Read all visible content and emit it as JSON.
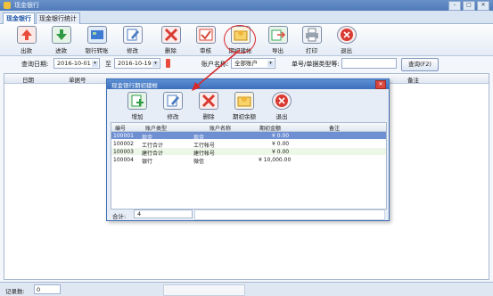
{
  "window": {
    "title": "现金银行",
    "min": "–",
    "max": "□",
    "close": "✕"
  },
  "tabs": [
    {
      "label": "现金银行"
    },
    {
      "label": "现金银行统计"
    }
  ],
  "toolbar": [
    {
      "label": "出款",
      "icon": "withdraw-icon",
      "color": "#e74c3c"
    },
    {
      "label": "进款",
      "icon": "deposit-icon",
      "color": "#2e9a43"
    },
    {
      "label": "银行转账",
      "icon": "bank-transfer-icon",
      "color": "#3c7bd1"
    },
    {
      "label": "修改",
      "icon": "edit-icon",
      "color": "#4d7fc2"
    },
    {
      "label": "删除",
      "icon": "delete-icon",
      "color": "#d93a32"
    },
    {
      "label": "审核",
      "icon": "audit-icon",
      "color": "#d94a3a"
    },
    {
      "label": "期初建帐",
      "icon": "opening-balance-icon",
      "color": "#f0b43a"
    },
    {
      "label": "导出",
      "icon": "export-icon",
      "color": "#3ca65c"
    },
    {
      "label": "打印",
      "icon": "print-icon",
      "color": "#7a8494"
    },
    {
      "label": "退出",
      "icon": "exit-icon",
      "color": "#d93a32"
    }
  ],
  "filter": {
    "date_label": "查询日期:",
    "date_from": "2016-10-01",
    "to_label": "至",
    "date_to": "2016-10-19",
    "account_label": "账户名称:",
    "account_value": "全部账户",
    "number_label": "单号/单据类型等:",
    "number_value": "",
    "query_button": "查询(F2)"
  },
  "grid": {
    "columns": [
      "日期",
      "单据号",
      "",
      "",
      "",
      "",
      "",
      "",
      "备注"
    ]
  },
  "status": {
    "label": "记录数:",
    "value": "0"
  },
  "dialog": {
    "title": "现金银行期初建帐",
    "close": "✕",
    "buttons": [
      {
        "label": "增加",
        "icon": "add-icon",
        "color": "#2e9a43"
      },
      {
        "label": "修改",
        "icon": "edit-icon",
        "color": "#4d7fc2"
      },
      {
        "label": "删除",
        "icon": "delete-icon",
        "color": "#d93a32"
      },
      {
        "label": "期初余额",
        "icon": "opening-balance-icon",
        "color": "#f0b43a"
      },
      {
        "label": "退出",
        "icon": "exit-icon",
        "color": "#d93a32"
      }
    ],
    "columns": [
      "编号",
      "账户类型",
      "账户名称",
      "期初金额",
      "备注"
    ],
    "rows": [
      {
        "code": "100001",
        "type": "现金",
        "name": "现金",
        "amount": "¥ 0.00",
        "note": ""
      },
      {
        "code": "100002",
        "type": "工行合计",
        "name": "工行帐号",
        "amount": "¥ 0.00",
        "note": ""
      },
      {
        "code": "100003",
        "type": "建行合计",
        "name": "建行帐号",
        "amount": "¥ 0.00",
        "note": ""
      },
      {
        "code": "100004",
        "type": "银行",
        "name": "微信",
        "amount": "¥ 10,000.00",
        "note": ""
      }
    ],
    "footer_label": "合计:",
    "footer_value": "4"
  }
}
